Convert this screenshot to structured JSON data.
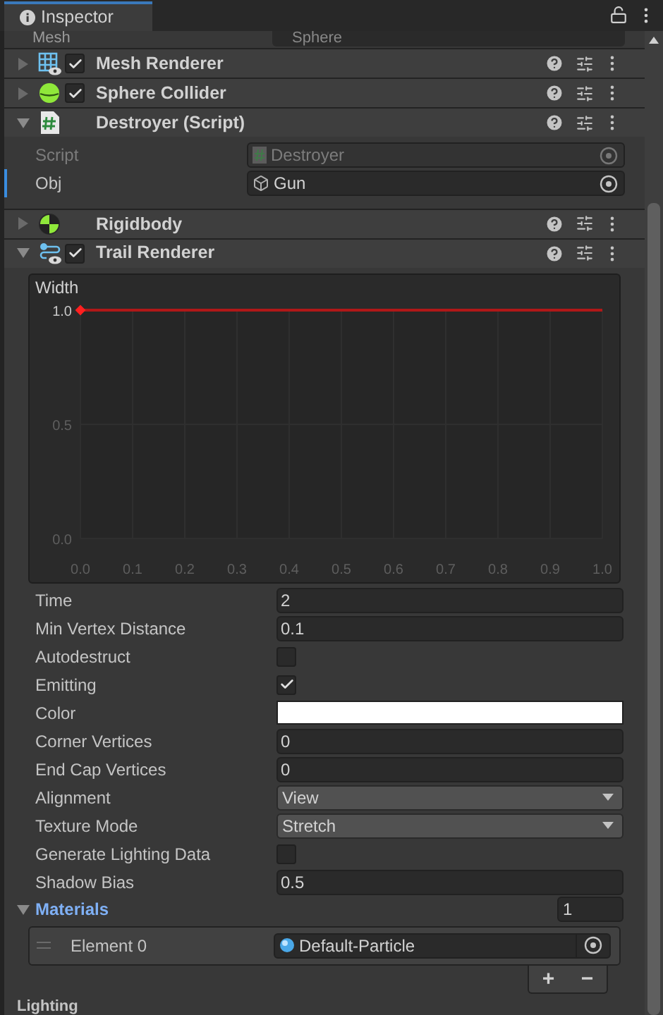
{
  "tab": {
    "title": "Inspector"
  },
  "top_field": {
    "label": "Mesh",
    "value": "Sphere"
  },
  "components": [
    {
      "name": "Mesh Renderer",
      "kind": "mesh-renderer",
      "expanded": false,
      "checked": true
    },
    {
      "name": "Sphere Collider",
      "kind": "collider",
      "expanded": false,
      "checked": true
    },
    {
      "name": "Destroyer (Script)",
      "kind": "script",
      "expanded": true,
      "fields": [
        {
          "label": "Script",
          "value": "Destroyer",
          "kind": "script",
          "disabled": true,
          "selected": false
        },
        {
          "label": "Obj",
          "value": "Gun",
          "kind": "object",
          "disabled": false,
          "selected": true
        }
      ]
    },
    {
      "name": "Rigidbody",
      "kind": "rigidbody",
      "expanded": false
    },
    {
      "name": "Trail Renderer",
      "kind": "trail-renderer",
      "expanded": true,
      "checked": true
    }
  ],
  "curve": {
    "chart_data": {
      "type": "line",
      "x": [
        0,
        1
      ],
      "series": [
        {
          "name": "Width",
          "color": "#b01818",
          "values": [
            1,
            1
          ]
        }
      ],
      "xlim": [
        0,
        1
      ],
      "ylim": [
        0,
        1
      ],
      "grid": true,
      "xticks": [
        {
          "value": 0,
          "label": "0.0"
        },
        0.1,
        0.2,
        0.3,
        0.4,
        0.5,
        0.6,
        0.7,
        0.8,
        0.9,
        {
          "value": 1,
          "label": "1.0"
        }
      ],
      "yticks": [
        {
          "value": 0,
          "label": "0.0"
        },
        0.5,
        {
          "value": 1,
          "label": "1.0"
        }
      ]
    }
  },
  "properties": [
    {
      "label": "Time",
      "kind": "number",
      "value": "2"
    },
    {
      "label": "Min Vertex Distance",
      "kind": "number",
      "value": "0.1"
    },
    {
      "label": "Autodestruct",
      "kind": "checkbox",
      "checked": false
    },
    {
      "label": "Emitting",
      "kind": "checkbox",
      "checked": true
    },
    {
      "label": "Color",
      "kind": "color",
      "color": "#ffffff"
    },
    {
      "label": "Corner Vertices",
      "kind": "number",
      "value": "0"
    },
    {
      "label": "End Cap Vertices",
      "kind": "number",
      "value": "0"
    },
    {
      "label": "Alignment",
      "kind": "dropdown",
      "value": "View"
    },
    {
      "label": "Texture Mode",
      "kind": "dropdown",
      "value": "Stretch"
    },
    {
      "label": "Generate Lighting Data",
      "kind": "checkbox",
      "checked": false
    },
    {
      "label": "Shadow Bias",
      "kind": "number",
      "value": "0.5"
    }
  ],
  "materials": {
    "label": "Materials",
    "expanded": true,
    "count": "1",
    "elements": [
      {
        "label": "Element 0",
        "value": "Default-Particle"
      }
    ],
    "add": "+",
    "remove": "−"
  },
  "next_section": {
    "label": "Lighting"
  }
}
